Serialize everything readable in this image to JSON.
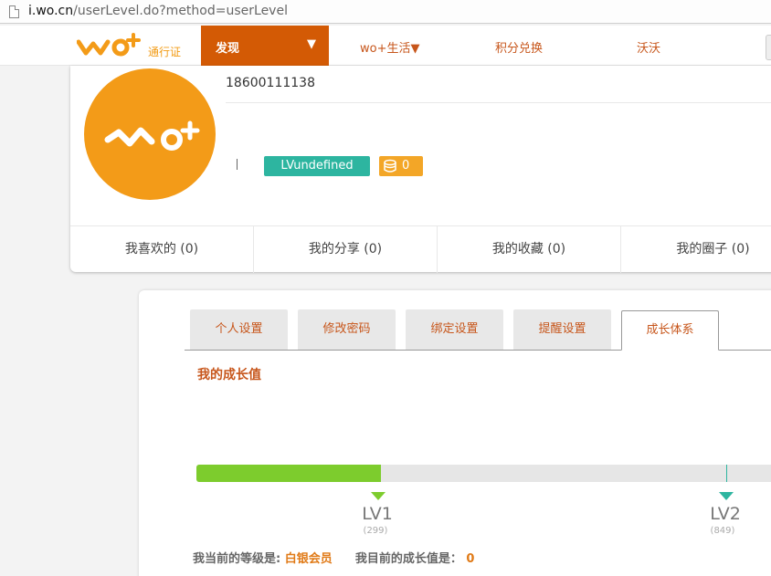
{
  "browser": {
    "url_host": "i.wo.cn",
    "url_path": "/userLevel.do?method=userLevel"
  },
  "nav": {
    "logo_subtitle": "通行证",
    "discover_label": "发现",
    "discover_arrow": "▼",
    "items": [
      {
        "label": "wo+生活▼"
      },
      {
        "label": "积分兑换"
      },
      {
        "label": "沃沃"
      }
    ]
  },
  "profile": {
    "phone": "18600111138",
    "level_badge": "LVundefined",
    "coins": "0",
    "stats": [
      {
        "label": "我喜欢的  (0)"
      },
      {
        "label": "我的分享 (0)"
      },
      {
        "label": "我的收藏  (0)"
      },
      {
        "label": "我的圈子 (0)"
      }
    ]
  },
  "settings": {
    "tabs": [
      {
        "label": "个人设置",
        "active": false
      },
      {
        "label": "修改密码",
        "active": false
      },
      {
        "label": "绑定设置",
        "active": false
      },
      {
        "label": "提醒设置",
        "active": false
      },
      {
        "label": "成长体系",
        "active": true
      }
    ],
    "section_title": "我的成长值",
    "growth": {
      "progress_fraction": 0.31,
      "levels": [
        {
          "label": "LV1",
          "points": "(299)"
        },
        {
          "label": "LV2",
          "points": "(849)"
        }
      ],
      "current_level_prefix": "我当前的等级是:",
      "current_level": "白银会员",
      "current_value_prefix": "我目前的成长值是：",
      "current_value": "0"
    }
  },
  "colors": {
    "brand_orange": "#d35a05",
    "text_orange": "#c7561b",
    "teal": "#2db5a0",
    "green": "#7dcc2d",
    "coin_orange": "#f3a627"
  }
}
